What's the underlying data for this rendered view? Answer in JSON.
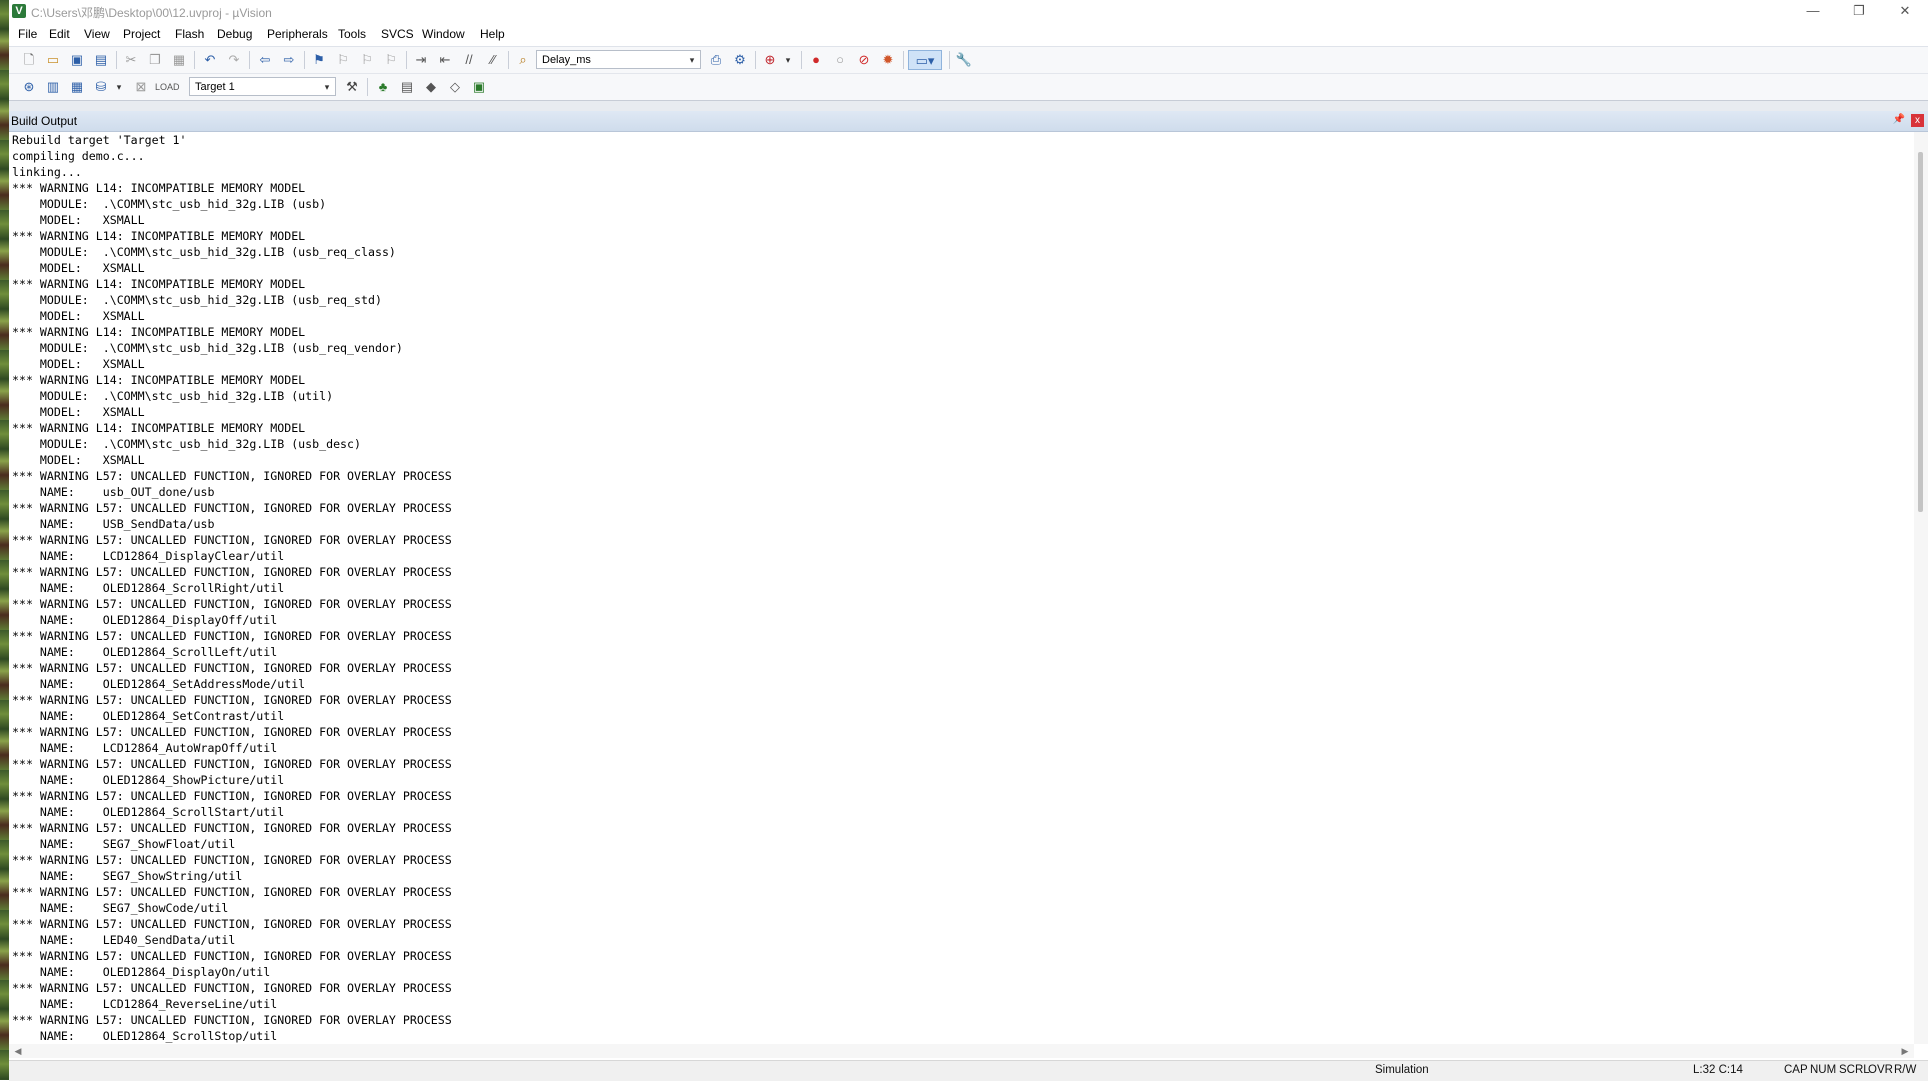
{
  "window": {
    "title": "C:\\Users\\邓鹏\\Desktop\\00\\12.uvproj - µVision",
    "app_icon_label": "V",
    "controls": {
      "minimize": "—",
      "restore": "❐",
      "close": "✕"
    }
  },
  "menu": [
    "File",
    "Edit",
    "View",
    "Project",
    "Flash",
    "Debug",
    "Peripherals",
    "Tools",
    "SVCS",
    "Window",
    "Help"
  ],
  "toolbar": {
    "find_combo": "Delay_ms",
    "target_combo": "Target 1"
  },
  "panel": {
    "title": "Build Output",
    "pin": "📌",
    "close": "x"
  },
  "output_lines": [
    "Rebuild target 'Target 1'",
    "compiling demo.c...",
    "linking...",
    "*** WARNING L14: INCOMPATIBLE MEMORY MODEL",
    "    MODULE:  .\\COMM\\stc_usb_hid_32g.LIB (usb)",
    "    MODEL:   XSMALL",
    "*** WARNING L14: INCOMPATIBLE MEMORY MODEL",
    "    MODULE:  .\\COMM\\stc_usb_hid_32g.LIB (usb_req_class)",
    "    MODEL:   XSMALL",
    "*** WARNING L14: INCOMPATIBLE MEMORY MODEL",
    "    MODULE:  .\\COMM\\stc_usb_hid_32g.LIB (usb_req_std)",
    "    MODEL:   XSMALL",
    "*** WARNING L14: INCOMPATIBLE MEMORY MODEL",
    "    MODULE:  .\\COMM\\stc_usb_hid_32g.LIB (usb_req_vendor)",
    "    MODEL:   XSMALL",
    "*** WARNING L14: INCOMPATIBLE MEMORY MODEL",
    "    MODULE:  .\\COMM\\stc_usb_hid_32g.LIB (util)",
    "    MODEL:   XSMALL",
    "*** WARNING L14: INCOMPATIBLE MEMORY MODEL",
    "    MODULE:  .\\COMM\\stc_usb_hid_32g.LIB (usb_desc)",
    "    MODEL:   XSMALL",
    "*** WARNING L57: UNCALLED FUNCTION, IGNORED FOR OVERLAY PROCESS",
    "    NAME:    usb_OUT_done/usb",
    "*** WARNING L57: UNCALLED FUNCTION, IGNORED FOR OVERLAY PROCESS",
    "    NAME:    USB_SendData/usb",
    "*** WARNING L57: UNCALLED FUNCTION, IGNORED FOR OVERLAY PROCESS",
    "    NAME:    LCD12864_DisplayClear/util",
    "*** WARNING L57: UNCALLED FUNCTION, IGNORED FOR OVERLAY PROCESS",
    "    NAME:    OLED12864_ScrollRight/util",
    "*** WARNING L57: UNCALLED FUNCTION, IGNORED FOR OVERLAY PROCESS",
    "    NAME:    OLED12864_DisplayOff/util",
    "*** WARNING L57: UNCALLED FUNCTION, IGNORED FOR OVERLAY PROCESS",
    "    NAME:    OLED12864_ScrollLeft/util",
    "*** WARNING L57: UNCALLED FUNCTION, IGNORED FOR OVERLAY PROCESS",
    "    NAME:    OLED12864_SetAddressMode/util",
    "*** WARNING L57: UNCALLED FUNCTION, IGNORED FOR OVERLAY PROCESS",
    "    NAME:    OLED12864_SetContrast/util",
    "*** WARNING L57: UNCALLED FUNCTION, IGNORED FOR OVERLAY PROCESS",
    "    NAME:    LCD12864_AutoWrapOff/util",
    "*** WARNING L57: UNCALLED FUNCTION, IGNORED FOR OVERLAY PROCESS",
    "    NAME:    OLED12864_ShowPicture/util",
    "*** WARNING L57: UNCALLED FUNCTION, IGNORED FOR OVERLAY PROCESS",
    "    NAME:    OLED12864_ScrollStart/util",
    "*** WARNING L57: UNCALLED FUNCTION, IGNORED FOR OVERLAY PROCESS",
    "    NAME:    SEG7_ShowFloat/util",
    "*** WARNING L57: UNCALLED FUNCTION, IGNORED FOR OVERLAY PROCESS",
    "    NAME:    SEG7_ShowString/util",
    "*** WARNING L57: UNCALLED FUNCTION, IGNORED FOR OVERLAY PROCESS",
    "    NAME:    SEG7_ShowCode/util",
    "*** WARNING L57: UNCALLED FUNCTION, IGNORED FOR OVERLAY PROCESS",
    "    NAME:    LED40_SendData/util",
    "*** WARNING L57: UNCALLED FUNCTION, IGNORED FOR OVERLAY PROCESS",
    "    NAME:    OLED12864_DisplayOn/util",
    "*** WARNING L57: UNCALLED FUNCTION, IGNORED FOR OVERLAY PROCESS",
    "    NAME:    LCD12864_ReverseLine/util",
    "*** WARNING L57: UNCALLED FUNCTION, IGNORED FOR OVERLAY PROCESS",
    "    NAME:    OLED12864_ScrollStop/util"
  ],
  "status": {
    "mode": "Simulation",
    "position": "L:32 C:14",
    "cap": "CAP",
    "num": "NUM",
    "scrl": "SCRL",
    "ovr": "OVR",
    "rw": "R/W"
  }
}
